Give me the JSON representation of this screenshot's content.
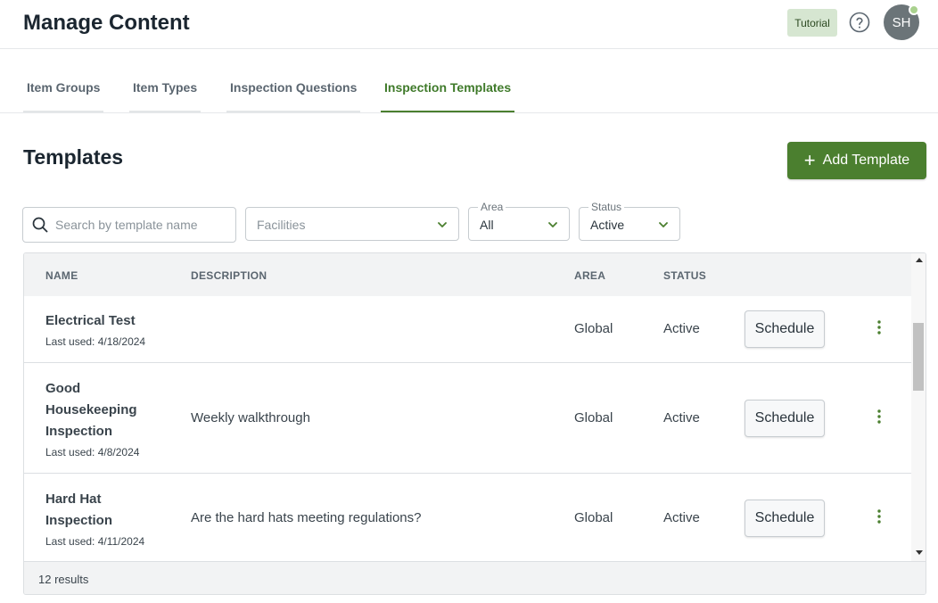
{
  "header": {
    "title": "Manage Content",
    "tutorial_label": "Tutorial",
    "avatar_initials": "SH"
  },
  "tabs": [
    {
      "label": "Item Groups",
      "active": false
    },
    {
      "label": "Item Types",
      "active": false
    },
    {
      "label": "Inspection Questions",
      "active": false
    },
    {
      "label": "Inspection Templates",
      "active": true
    }
  ],
  "section": {
    "title": "Templates",
    "add_label": "Add Template"
  },
  "filters": {
    "search_placeholder": "Search by template name",
    "facilities_placeholder": "Facilities",
    "area_label": "Area",
    "area_value": "All",
    "status_label": "Status",
    "status_value": "Active"
  },
  "table": {
    "columns": [
      "NAME",
      "DESCRIPTION",
      "AREA",
      "STATUS"
    ],
    "rows": [
      {
        "name": "Electrical Test",
        "last_used": "Last used: 4/18/2024",
        "description": "",
        "area": "Global",
        "status": "Active",
        "action": "Schedule"
      },
      {
        "name": "Good Housekeeping Inspection",
        "last_used": "Last used: 4/8/2024",
        "description": "Weekly walkthrough",
        "area": "Global",
        "status": "Active",
        "action": "Schedule"
      },
      {
        "name": "Hard Hat Inspection",
        "last_used": "Last used: 4/11/2024",
        "description": "Are the hard hats meeting regulations?",
        "area": "Global",
        "status": "Active",
        "action": "Schedule"
      }
    ],
    "results_text": "12 results"
  },
  "colors": {
    "brand_green": "#4b7f2f",
    "tutorial_bg": "#d6e6d1",
    "avatar_bg": "#6b7478",
    "online_dot": "#a9d18e"
  },
  "icons": {
    "help": "help-circle-icon",
    "search": "search-icon",
    "chevron": "chevron-down-icon",
    "more": "kebab-icon",
    "add": "plus-icon"
  }
}
